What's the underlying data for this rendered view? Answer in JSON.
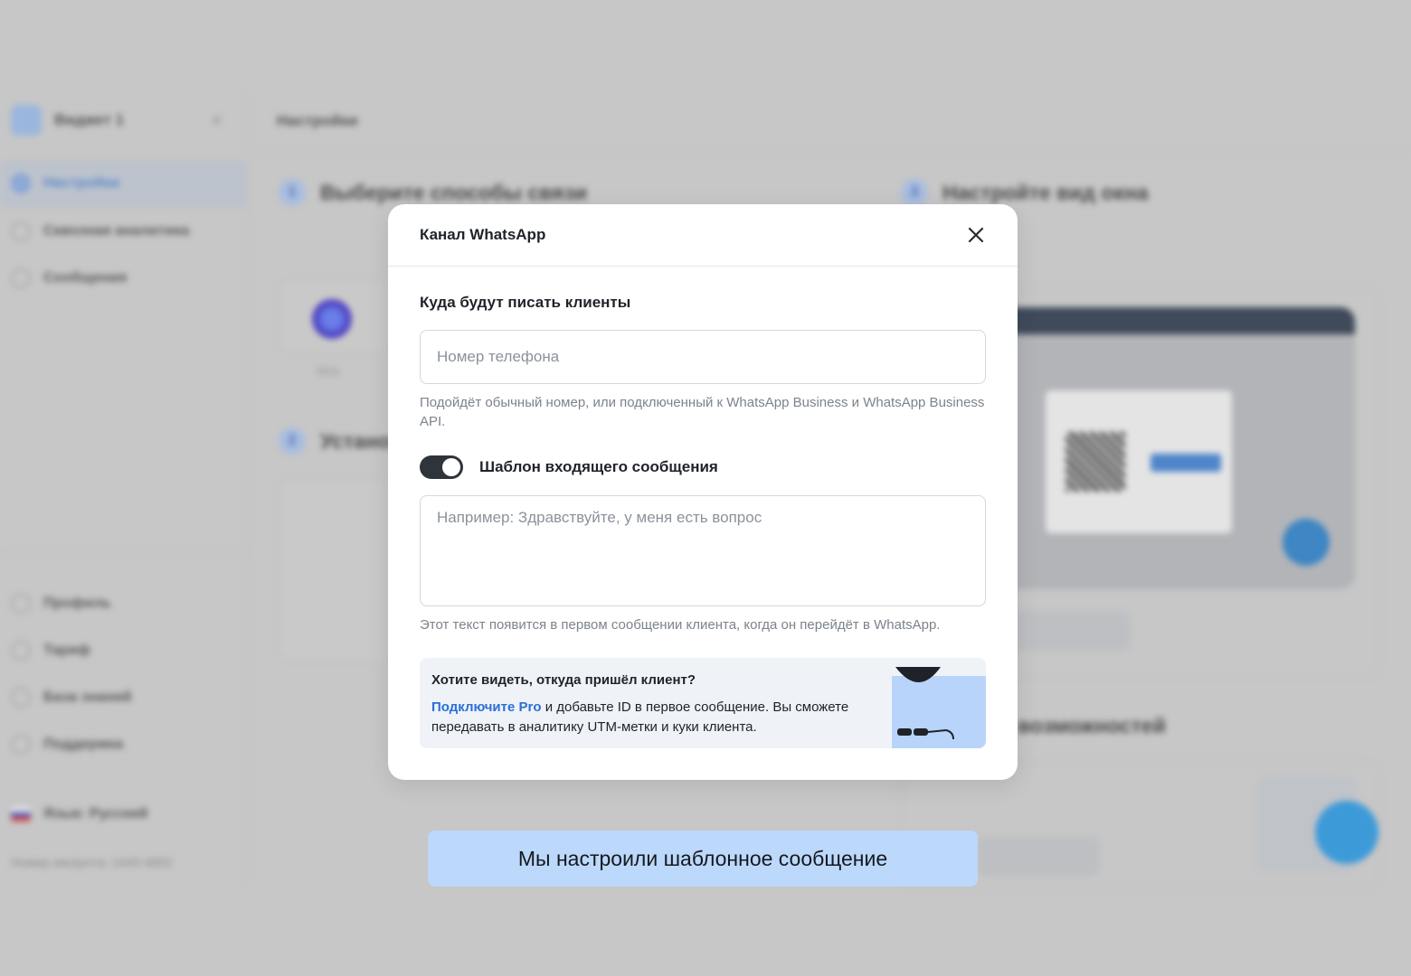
{
  "sidebar": {
    "widget_name": "Виджет 1",
    "items": [
      {
        "label": "Настройки"
      },
      {
        "label": "Сквозная аналитика"
      },
      {
        "label": "Сообщения"
      }
    ],
    "bottom_items": [
      {
        "label": "Профиль"
      },
      {
        "label": "Тариф"
      },
      {
        "label": "База знаний"
      },
      {
        "label": "Поддержка"
      }
    ],
    "language": "Язык: Русский",
    "account": "Номер аккаунта: 1443-4802"
  },
  "header": {
    "title": "Настройки"
  },
  "main": {
    "step1": {
      "num": "1",
      "title": "Выберите способы связи"
    },
    "step2": {
      "num": "2",
      "title": "Установите"
    },
    "step3": {
      "num": "3",
      "title": "Настройте вид окна"
    },
    "more_title": "возможностей",
    "max_label": "Max"
  },
  "modal": {
    "title": "Канал WhatsApp",
    "section_label": "Куда будут писать клиенты",
    "phone_placeholder": "Номер телефона",
    "phone_hint": "Подойдёт обычный номер, или подключенный к WhatsApp Business и WhatsApp Business API.",
    "toggle_label": "Шаблон входящего сообщения",
    "toggle_on": true,
    "message_placeholder": "Например: Здравствуйте, у меня есть вопрос",
    "message_hint": "Этот текст появится в первом сообщении клиента, когда он перейдёт в WhatsApp.",
    "pro": {
      "title": "Хотите видеть, откуда пришёл клиент?",
      "link": "Подключите Pro",
      "text": " и добавьте ID в первое сообщение. Вы сможете передавать в аналитику UTM-метки и куки клиента."
    }
  },
  "caption": "Мы настроили шаблонное сообщение",
  "colors": {
    "toggle": "#2f343b",
    "link": "#2a6fd6",
    "caption_bg": "#bcd8fb",
    "pro_bg": "#eff3f8"
  }
}
